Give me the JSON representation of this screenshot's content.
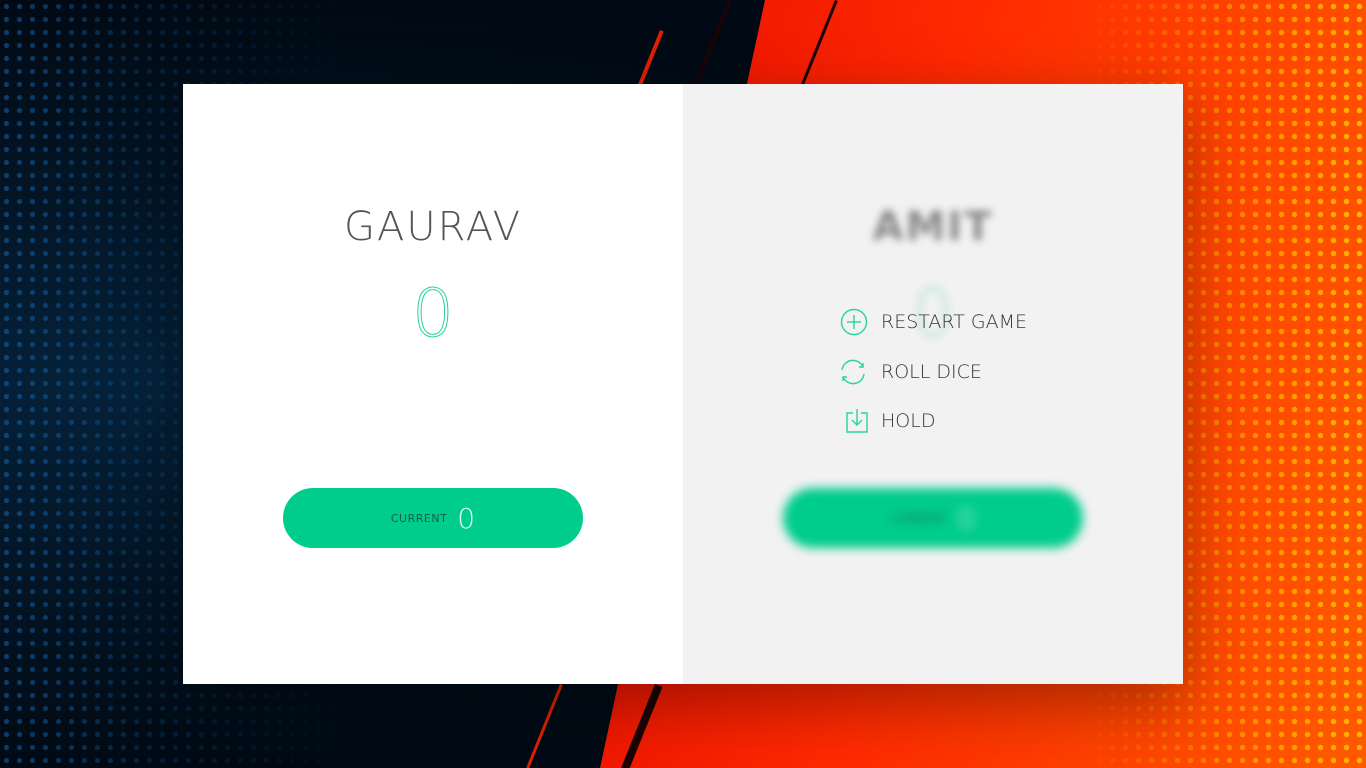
{
  "players": [
    {
      "name": "GAURAV",
      "score": "0",
      "current_label": "CURRENT",
      "current_score": "0",
      "active": true
    },
    {
      "name": "AMIT",
      "score": "0",
      "current_label": "CURRENT",
      "current_score": "0",
      "active": false
    }
  ],
  "controls": {
    "new_game": "RESTART GAME",
    "roll_dice": "ROLL DICE",
    "hold": "HOLD"
  },
  "colors": {
    "accent": "#00cc8c",
    "panel_active": "#ffffff",
    "panel_inactive": "#f2f2f2",
    "text": "#555555"
  },
  "icons": {
    "new_game": "plus-circle-icon",
    "roll_dice": "refresh-icon",
    "hold": "download-icon"
  }
}
